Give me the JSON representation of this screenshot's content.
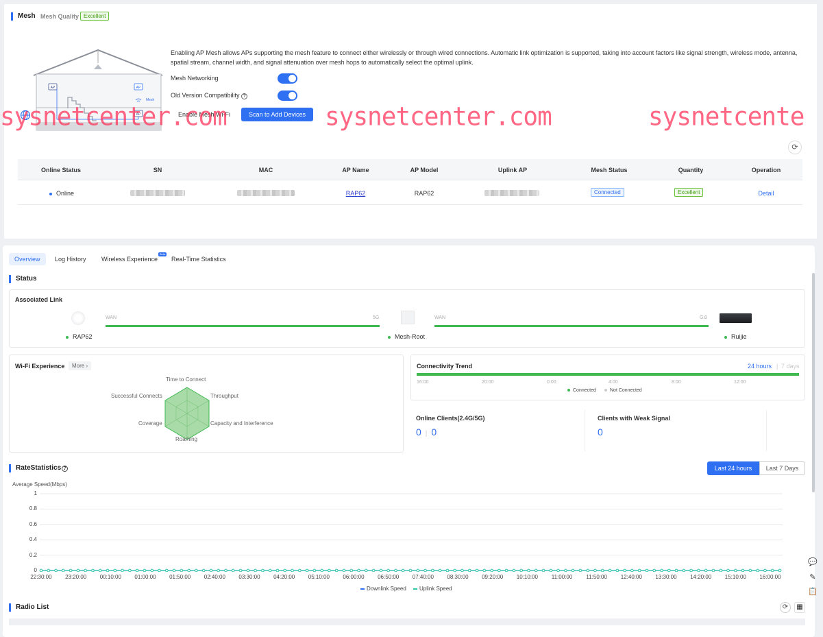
{
  "mesh": {
    "title": "Mesh",
    "quality_label": "Mesh Quality",
    "quality_value": "Excellent",
    "description": "Enabling AP Mesh allows APs supporting the mesh feature to connect either wirelessly or through wired connections. Automatic link optimization is supported, taking into account factors like signal strength, wireless mode, antenna, spatial stream, channel width, and signal attenuation over mesh hops to automatically select the optimal uplink.",
    "mesh_networking_label": "Mesh Networking",
    "old_version_label": "Old Version Compatibility",
    "enable_mesh_wifi_label": "Enable Mesh Wi-Fi",
    "scan_button": "Scan to Add Devices",
    "illustration": {
      "ap1": "AP",
      "ap2": "AP",
      "ap3": "AP",
      "mesh": "Mesh"
    },
    "toggles": {
      "mesh_networking": true,
      "old_version_compatibility": true
    }
  },
  "watermark": {
    "text1": "sysnetcenter.com",
    "text2": "sysnetcenter.com",
    "text3": "sysnetcente"
  },
  "table": {
    "headers": [
      "Online Status",
      "SN",
      "MAC",
      "AP Name",
      "AP Model",
      "Uplink AP",
      "Mesh Status",
      "Quantity",
      "Operation"
    ],
    "row": {
      "online_status": "Online",
      "ap_name": "RAP62",
      "ap_model": "RAP62",
      "mesh_status": "Connected",
      "quantity": "Excellent",
      "operation": "Detail"
    }
  },
  "tabs": [
    {
      "label": "Overview",
      "active": true
    },
    {
      "label": "Log History"
    },
    {
      "label": "Wireless Experience",
      "badge": "Beta"
    },
    {
      "label": "Real-Time Statistics"
    }
  ],
  "status": {
    "title": "Status",
    "associated_link": {
      "title": "Associated Link",
      "nodes": [
        "RAP62",
        "Mesh-Root",
        "Ruijie"
      ],
      "link1": {
        "left": "WAN",
        "right": "5G"
      },
      "link2": {
        "left": "WAN",
        "right": "Gi3"
      }
    },
    "wifi_experience": {
      "title": "Wi-Fi Experience",
      "more": "More",
      "axes": [
        "Time to Connect",
        "Throughput",
        "Capacity and Interference",
        "Roaming",
        "Coverage",
        "Successful Connects"
      ]
    },
    "connectivity": {
      "title": "Connectivity Trend",
      "range_active": "24 hours",
      "range_other": "7 days",
      "ticks": [
        "16:00",
        "20:00",
        "0:00",
        "4:00",
        "8:00",
        "12:00"
      ],
      "legend_connected": "Connected",
      "legend_not_connected": "Not Connected"
    },
    "online_clients": {
      "label": "Online Clients(2.4G/5G)",
      "value_24g": "0",
      "value_5g": "0"
    },
    "weak_signal": {
      "label": "Clients with Weak Signal",
      "value": "0"
    }
  },
  "rate": {
    "title": "RateStatistics",
    "btn_24h": "Last 24 hours",
    "btn_7d": "Last 7 Days",
    "ylabel": "Average Speed(Mbps)"
  },
  "chart_data": {
    "type": "line",
    "ylabel": "Average Speed(Mbps)",
    "ylim": [
      0,
      1
    ],
    "yticks": [
      "1",
      "0.8",
      "0.6",
      "0.4",
      "0.2",
      "0"
    ],
    "xticks": [
      "22:30:00",
      "23:20:00",
      "00:10:00",
      "01:00:00",
      "01:50:00",
      "02:40:00",
      "03:30:00",
      "04:20:00",
      "05:10:00",
      "06:00:00",
      "06:50:00",
      "07:40:00",
      "08:30:00",
      "09:20:00",
      "10:10:00",
      "11:00:00",
      "11:50:00",
      "12:40:00",
      "13:30:00",
      "14:20:00",
      "15:10:00",
      "16:00:00"
    ],
    "series": [
      {
        "name": "Downlink Speed",
        "color": "#2f6ff2",
        "values": [
          0,
          0,
          0,
          0,
          0,
          0,
          0,
          0,
          0,
          0,
          0,
          0,
          0,
          0,
          0,
          0,
          0,
          0,
          0,
          0,
          0,
          0
        ]
      },
      {
        "name": "Uplink Speed",
        "color": "#2fc9a8",
        "values": [
          0,
          0,
          0,
          0,
          0,
          0,
          0,
          0,
          0,
          0,
          0,
          0,
          0,
          0,
          0,
          0,
          0,
          0,
          0,
          0,
          0,
          0
        ]
      }
    ],
    "legend": "bottom"
  },
  "radio_list": {
    "title": "Radio List"
  }
}
